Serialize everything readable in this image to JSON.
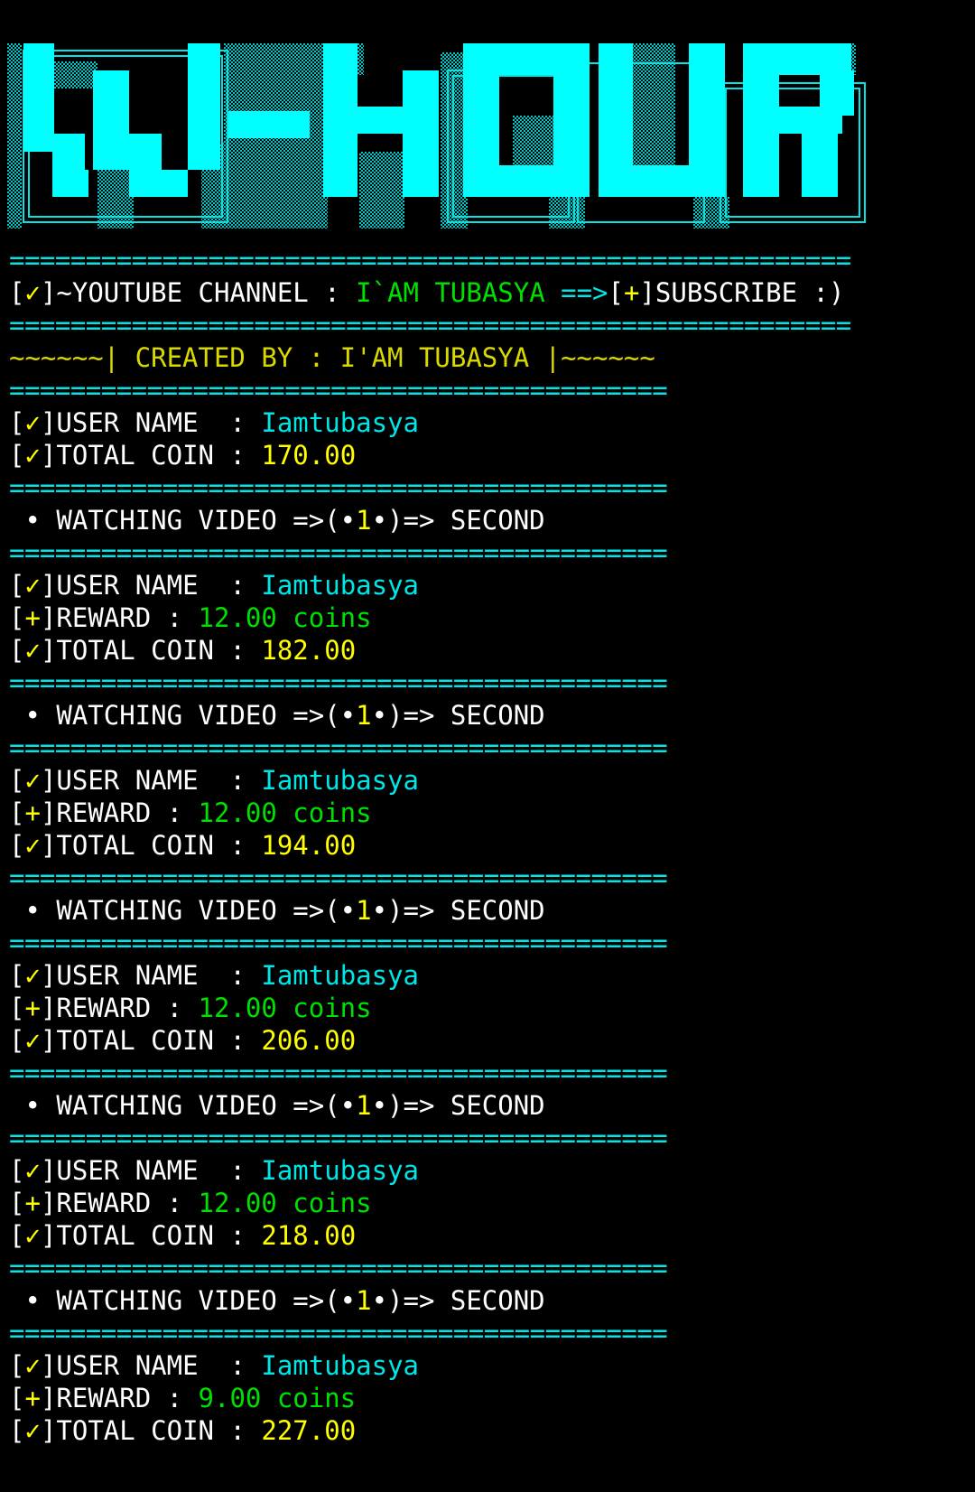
{
  "banner": {
    "text": "W-HOUR",
    "colors": {
      "main": "#00ffff",
      "shade": "#00e5e5",
      "background": "#000000"
    }
  },
  "separators": {
    "long": "=======================================================",
    "short": "==========================================="
  },
  "header": {
    "check_mark": "✓",
    "plus_mark": "+",
    "channel_label": "~YOUTUBE CHANNEL : ",
    "channel_name": "I`AM TUBASYA",
    "arrow": " ==>",
    "subscribe_text": "SUBSCRIBE :)"
  },
  "credits": {
    "text": "~~~~~~| CREATED BY : I'AM TUBASYA |~~~~~~"
  },
  "initial": {
    "username_label": "USER NAME  : ",
    "username": "Iamtubasya",
    "total_label": "TOTAL COIN : ",
    "total": "170.00"
  },
  "watching": {
    "prefix": " • WATCHING VIDEO =>(•",
    "seconds": "1",
    "suffix": "•)=> SECOND"
  },
  "cycles": [
    {
      "username": "Iamtubasya",
      "reward": "12.00 coins",
      "total": "182.00"
    },
    {
      "username": "Iamtubasya",
      "reward": "12.00 coins",
      "total": "194.00"
    },
    {
      "username": "Iamtubasya",
      "reward": "12.00 coins",
      "total": "206.00"
    },
    {
      "username": "Iamtubasya",
      "reward": "12.00 coins",
      "total": "218.00"
    },
    {
      "username": "Iamtubasya",
      "reward": "9.00 coins",
      "total": "227.00"
    }
  ],
  "labels": {
    "username_label": "USER NAME  : ",
    "reward_label": "REWARD : ",
    "total_label": "TOTAL COIN : "
  }
}
